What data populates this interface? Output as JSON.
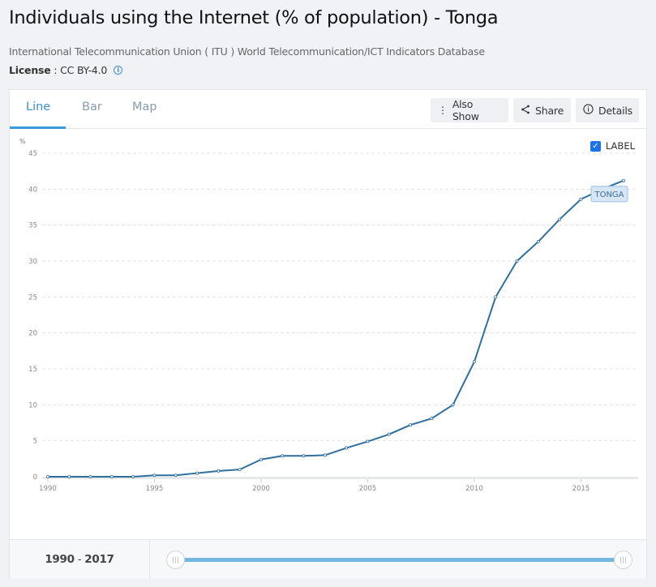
{
  "header": {
    "title": "Individuals using the Internet (% of population) - Tonga",
    "source": "International Telecommunication Union ( ITU ) World Telecommunication/ICT Indicators Database",
    "license_label": "License",
    "license_sep": " : ",
    "license_value": "CC BY-4.0",
    "license_info_icon": "info-icon"
  },
  "tabs": [
    {
      "label": "Line",
      "active": true
    },
    {
      "label": "Bar",
      "active": false
    },
    {
      "label": "Map",
      "active": false
    }
  ],
  "toolbar": {
    "also_show": {
      "label": "Also Show",
      "icon": "vertical-ellipsis-icon"
    },
    "share": {
      "label": "Share",
      "icon": "share-icon"
    },
    "details": {
      "label": "Details",
      "icon": "info-icon"
    }
  },
  "label_toggle": {
    "label": "LABEL",
    "checked": true
  },
  "footer": {
    "range_start": "1990",
    "range_sep": " - ",
    "range_end": "2017",
    "slider": {
      "min": 1990,
      "max": 2017,
      "from": 1990,
      "to": 2017
    }
  },
  "colors": {
    "accent": "#3a8fd0",
    "series": "#2f6f9f",
    "slider": "#74b7e0",
    "series_label_bg": "#d6e6f4"
  },
  "chart_data": {
    "type": "line",
    "title": "Individuals using the Internet (% of population) - Tonga",
    "xlabel": "",
    "ylabel": "%",
    "ylim": [
      0,
      45
    ],
    "yticks": [
      0,
      5,
      10,
      15,
      20,
      25,
      30,
      35,
      40,
      45
    ],
    "xlim": [
      1990,
      2017
    ],
    "xticks": [
      1990,
      1995,
      2000,
      2005,
      2010,
      2015
    ],
    "grid": true,
    "legend": "none",
    "x": [
      1990,
      1991,
      1992,
      1993,
      1994,
      1995,
      1996,
      1997,
      1998,
      1999,
      2000,
      2001,
      2002,
      2003,
      2004,
      2005,
      2006,
      2007,
      2008,
      2009,
      2010,
      2011,
      2012,
      2013,
      2014,
      2015,
      2016,
      2017
    ],
    "series": [
      {
        "name": "TONGA",
        "values": [
          0,
          0,
          0,
          0,
          0,
          0.2,
          0.2,
          0.5,
          0.8,
          1.0,
          2.4,
          2.9,
          2.9,
          3.0,
          4.0,
          4.9,
          5.9,
          7.2,
          8.1,
          10.0,
          16.0,
          25.0,
          30.0,
          32.7,
          35.8,
          38.6,
          40.0,
          41.2
        ],
        "end_label": "TONGA"
      }
    ]
  }
}
